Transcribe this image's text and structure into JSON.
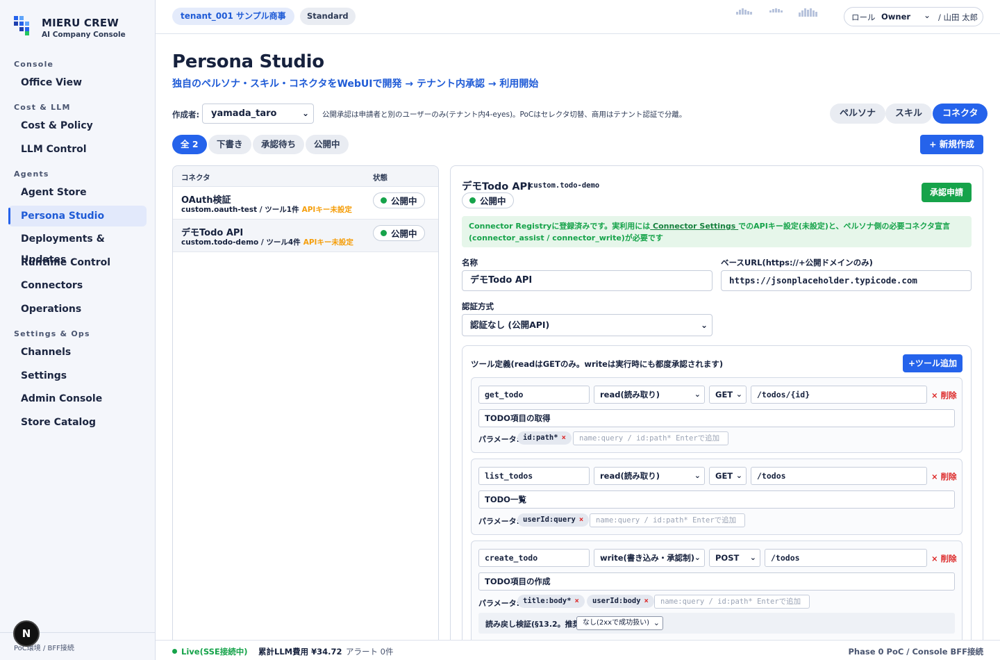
{
  "brand": {
    "name": "MIERU CREW",
    "subtitle": "AI Company Console"
  },
  "sidebar": {
    "sections": [
      "Console",
      "Cost & LLM",
      "Agents",
      "Settings & Ops"
    ],
    "items": [
      "Office View",
      "Cost & Policy",
      "LLM Control",
      "Agent Store",
      "Persona Studio",
      "Deployments & Updates",
      "Runtime Control",
      "Connectors",
      "Operations",
      "Channels",
      "Settings",
      "Admin Console",
      "Store Catalog"
    ],
    "active": "Persona Studio",
    "footer": "PoC環境 / BFF接続",
    "badge": "N"
  },
  "topbar": {
    "tenant": "tenant_001 サンプル商事",
    "plan": "Standard",
    "role_label": "ロール",
    "role_value": "Owner",
    "user": "/ 山田 太郎"
  },
  "page": {
    "title": "Persona Studio",
    "subtitle": "独自のペルソナ・スキル・コネクタをWebUIで開発 → テナント内承認 → 利用開始",
    "author_label": "作成者:",
    "author_value": "yamada_taro",
    "author_note": "公開承認は申請者と別のユーザーのみ(テナント内4-eyes)。PoCはセレクタ切替、商用はテナント認証で分離。",
    "kinds": [
      "ペルソナ",
      "スキル",
      "コネクタ"
    ],
    "active_kind": "コネクタ",
    "filters": [
      "全 2",
      "下書き",
      "承認待ち",
      "公開中"
    ],
    "active_filter": "全 2",
    "new_button": "+ 新規作成"
  },
  "list": {
    "columns": [
      "コネクタ",
      "状態"
    ],
    "rows": [
      {
        "name": "OAuth検証",
        "meta": "custom.oauth-test / ツール1件",
        "warn": "APIキー未設定",
        "status": "公開中"
      },
      {
        "name": "デモTodo API",
        "meta": "custom.todo-demo / ツール4件",
        "warn": "APIキー未設定",
        "status": "公開中"
      }
    ]
  },
  "detail": {
    "name": "デモTodo API",
    "id": "custom.todo-demo",
    "status": "公開中",
    "approve_button": "承認申請",
    "notice_pre": "Connector Registryに登録済みです。実利用には",
    "notice_link": " Connector Settings ",
    "notice_post": "でのAPIキー設定(未設定)と、ペルソナ側の必要コネクタ宣言(connector_assist / connector_write)が必要です",
    "name_label": "名称",
    "name_value": "デモTodo API",
    "url_label": "ベースURL(https://+公開ドメインのみ)",
    "url_value": "https://jsonplaceholder.typicode.com",
    "auth_label": "認証方式",
    "auth_value": "認証なし (公開API)",
    "tools_title": "ツール定義(readはGETのみ。writeは実行時にも都度承認されます)",
    "add_tool": "+ツール追加",
    "param_label": "パラメータ:",
    "param_placeholder": "name:query / id:path* Enterで追加",
    "delete_label": "× 削除",
    "verify_label": "読み戻し検証(§13.2。推奨):",
    "verify_value": "なし(2xxで成功扱い)",
    "tools": [
      {
        "name": "get_todo",
        "mode": "read(読み取り)",
        "method": "GET",
        "path": "/todos/{id}",
        "desc": "TODO項目の取得",
        "params": [
          "id:path*"
        ]
      },
      {
        "name": "list_todos",
        "mode": "read(読み取り)",
        "method": "GET",
        "path": "/todos",
        "desc": "TODO一覧",
        "params": [
          "userId:query"
        ]
      },
      {
        "name": "create_todo",
        "mode": "write(書き込み・承認制)",
        "method": "POST",
        "path": "/todos",
        "desc": "TODO項目の作成",
        "params": [
          "title:body*",
          "userId:body"
        ]
      }
    ]
  },
  "statusbar": {
    "live": "Live(SSE接続中)",
    "cost": "累計LLM費用 ¥34.72",
    "alerts": "アラート 0件",
    "phase": "Phase 0 PoC / Console BFF接続"
  },
  "colors": {
    "accent": "#2563eb",
    "success": "#16a34a",
    "danger": "#dc2626",
    "warning": "#f59e0b"
  }
}
